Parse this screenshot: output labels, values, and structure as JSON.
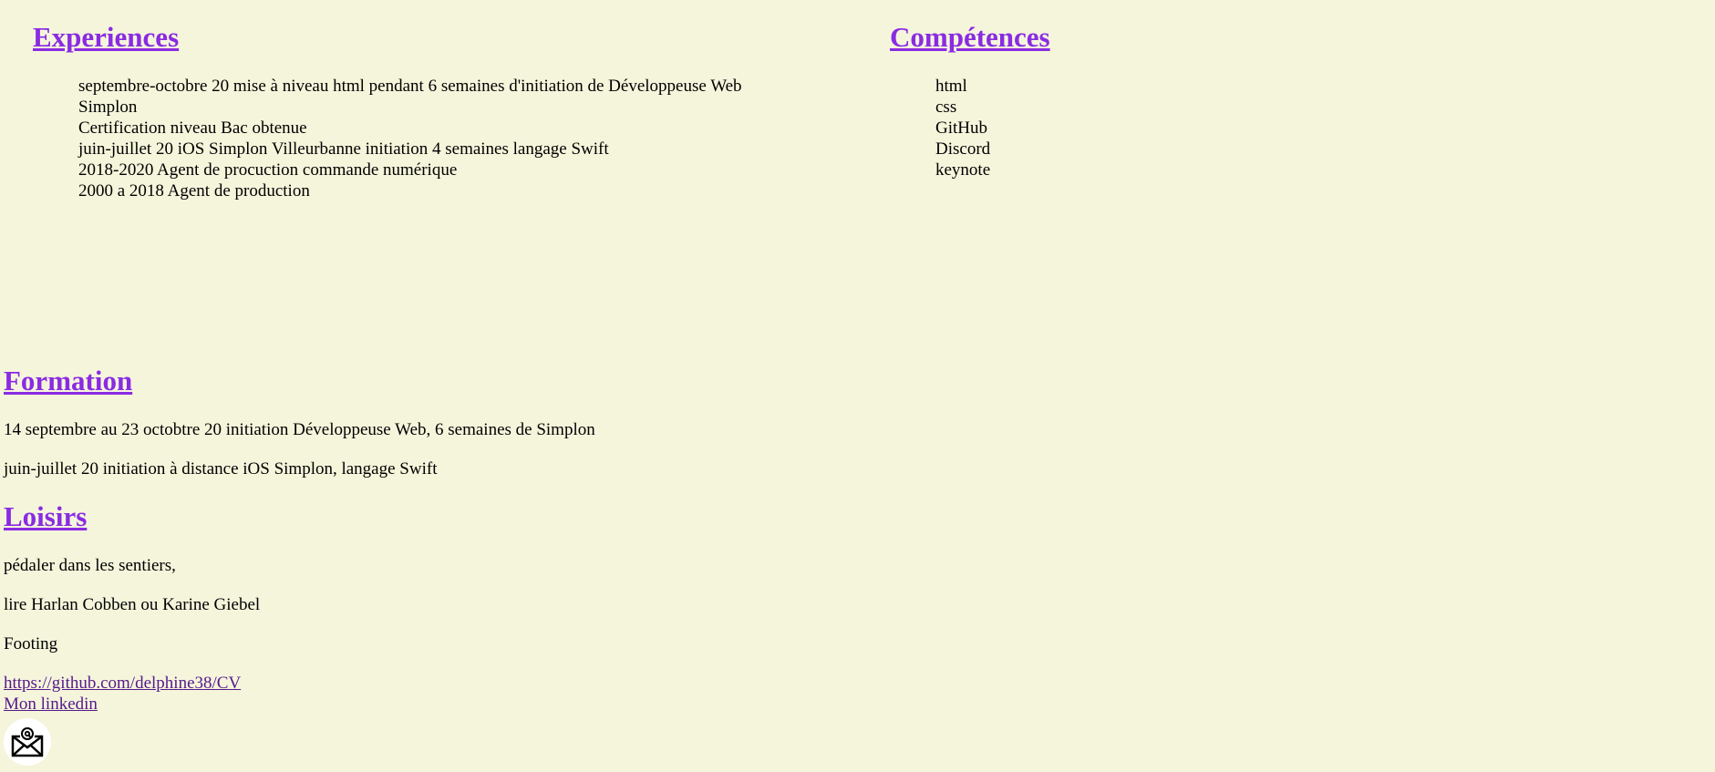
{
  "experiences": {
    "title": "Experiences",
    "items": [
      "septembre-octobre 20 mise à niveau html pendant 6 semaines d'initiation de Développeuse Web Simplon",
      "Certification niveau Bac obtenue",
      "juin-juillet 20 iOS Simplon Villeurbanne initiation 4 semaines langage Swift",
      "2018-2020 Agent de procuction commande numérique",
      "2000 a 2018 Agent de production"
    ]
  },
  "competences": {
    "title": "Compétences",
    "items": [
      "html",
      "css",
      "GitHub",
      "Discord",
      "keynote"
    ]
  },
  "formation": {
    "title": "Formation",
    "items": [
      "14 septembre au 23 octobtre 20 initiation Développeuse Web, 6 semaines de Simplon",
      "juin-juillet 20 initiation à distance iOS Simplon, langage Swift"
    ]
  },
  "loisirs": {
    "title": "Loisirs",
    "items": [
      "pédaler dans les sentiers,",
      "lire Harlan Cobben ou Karine Giebel",
      "Footing"
    ]
  },
  "links": {
    "github": "https://github.com/delphine38/CV",
    "linkedin": "Mon linkedin"
  },
  "mail_icon": "envelope-at-icon",
  "colors": {
    "background": "#f5f5dc",
    "heading": "#8a2be2",
    "link": "#551a8b"
  }
}
